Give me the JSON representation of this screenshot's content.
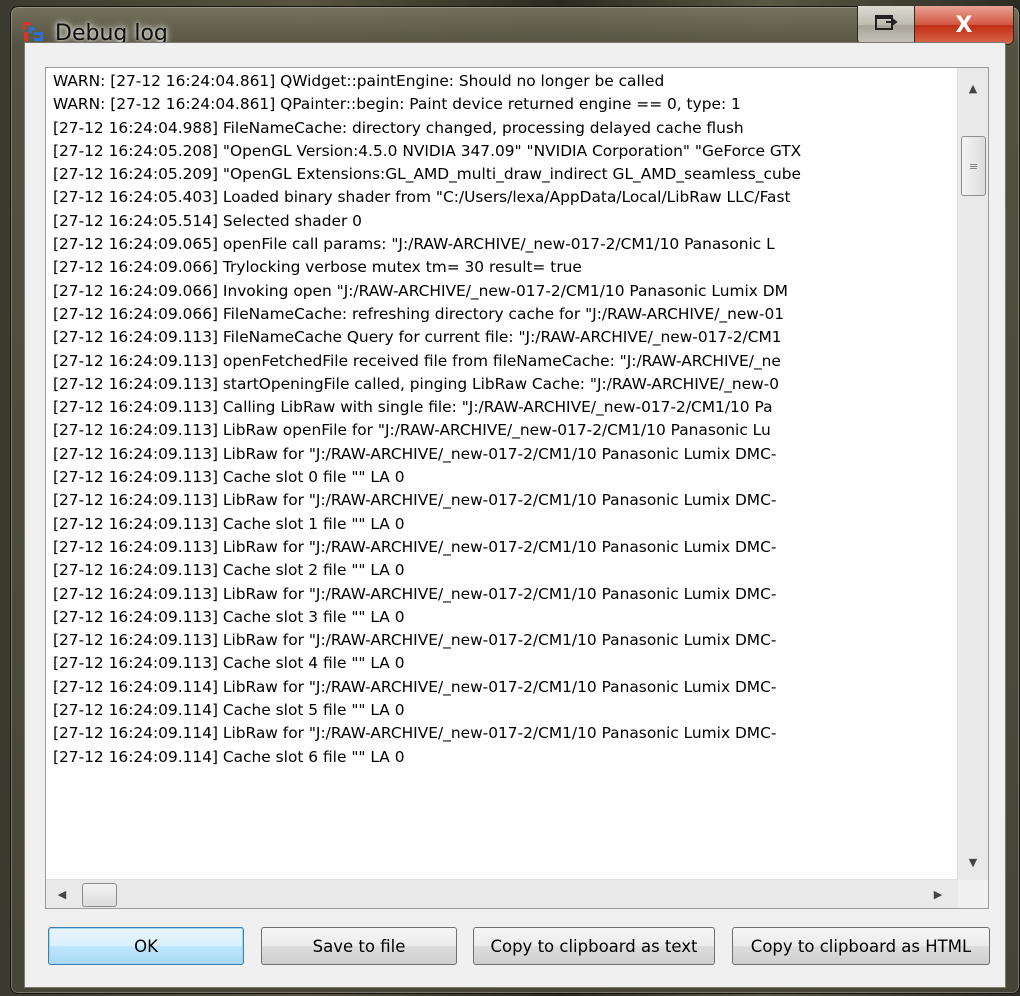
{
  "window": {
    "title": "Debug log",
    "close_glyph": "X",
    "accent": "#3c7fb1",
    "icons": {
      "app": "app-logo-icon",
      "restore": "restore-window-icon",
      "close": "close-icon"
    }
  },
  "log": {
    "lines": [
      "WARN: [27-12 16:24:04.861] QWidget::paintEngine: Should no longer be called",
      "WARN: [27-12 16:24:04.861] QPainter::begin: Paint device returned engine == 0, type: 1",
      "[27-12 16:24:04.988] FileNameCache: directory changed, processing delayed cache flush",
      "[27-12 16:24:05.208] \"OpenGL Version:4.5.0 NVIDIA 347.09\" \"NVIDIA Corporation\" \"GeForce GTX",
      "[27-12 16:24:05.209] \"OpenGL Extensions:GL_AMD_multi_draw_indirect GL_AMD_seamless_cube",
      "[27-12 16:24:05.403] Loaded binary shader from \"C:/Users/lexa/AppData/Local/LibRaw LLC/Fast",
      "[27-12 16:24:05.514] Selected shader 0",
      "[27-12 16:24:09.065] openFile call params: \"J:/RAW-ARCHIVE/_new-017-2/CM1/10 Panasonic L",
      "[27-12 16:24:09.066] Trylocking verbose mutex tm= 30 result= true",
      "[27-12 16:24:09.066] Invoking open \"J:/RAW-ARCHIVE/_new-017-2/CM1/10 Panasonic Lumix DM",
      "[27-12 16:24:09.066] FileNameCache: refreshing directory cache for \"J:/RAW-ARCHIVE/_new-01",
      "[27-12 16:24:09.113] FileNameCache Query for current file: \"J:/RAW-ARCHIVE/_new-017-2/CM1",
      "[27-12 16:24:09.113] openFetchedFile received file from fileNameCache: \"J:/RAW-ARCHIVE/_ne",
      "[27-12 16:24:09.113] startOpeningFile called, pinging LibRaw Cache: \"J:/RAW-ARCHIVE/_new-0",
      "[27-12 16:24:09.113] Calling LibRaw with single file: \"J:/RAW-ARCHIVE/_new-017-2/CM1/10 Pa",
      "[27-12 16:24:09.113] LibRaw openFile for \"J:/RAW-ARCHIVE/_new-017-2/CM1/10 Panasonic Lu",
      "[27-12 16:24:09.113] LibRaw for \"J:/RAW-ARCHIVE/_new-017-2/CM1/10 Panasonic Lumix DMC-",
      "[27-12 16:24:09.113] Cache slot 0 file \"\" LA 0",
      "[27-12 16:24:09.113] LibRaw for \"J:/RAW-ARCHIVE/_new-017-2/CM1/10 Panasonic Lumix DMC-",
      "[27-12 16:24:09.113] Cache slot 1 file \"\" LA 0",
      "[27-12 16:24:09.113] LibRaw for \"J:/RAW-ARCHIVE/_new-017-2/CM1/10 Panasonic Lumix DMC-",
      "[27-12 16:24:09.113] Cache slot 2 file \"\" LA 0",
      "[27-12 16:24:09.113] LibRaw for \"J:/RAW-ARCHIVE/_new-017-2/CM1/10 Panasonic Lumix DMC-",
      "[27-12 16:24:09.113] Cache slot 3 file \"\" LA 0",
      "[27-12 16:24:09.113] LibRaw for \"J:/RAW-ARCHIVE/_new-017-2/CM1/10 Panasonic Lumix DMC-",
      "[27-12 16:24:09.113] Cache slot 4 file \"\" LA 0",
      "[27-12 16:24:09.114] LibRaw for \"J:/RAW-ARCHIVE/_new-017-2/CM1/10 Panasonic Lumix DMC-",
      "[27-12 16:24:09.114] Cache slot 5 file \"\" LA 0",
      "[27-12 16:24:09.114] LibRaw for \"J:/RAW-ARCHIVE/_new-017-2/CM1/10 Panasonic Lumix DMC-",
      "[27-12 16:24:09.114] Cache slot 6 file \"\" LA 0"
    ],
    "scrollbars": {
      "up_glyph": "▲",
      "down_glyph": "▼",
      "left_glyph": "◀",
      "right_glyph": "▶",
      "grip_glyph": "≡"
    }
  },
  "buttons": {
    "ok": "OK",
    "save": "Save to file",
    "copy_text": "Copy to clipboard as text",
    "copy_html": "Copy to clipboard as HTML"
  }
}
